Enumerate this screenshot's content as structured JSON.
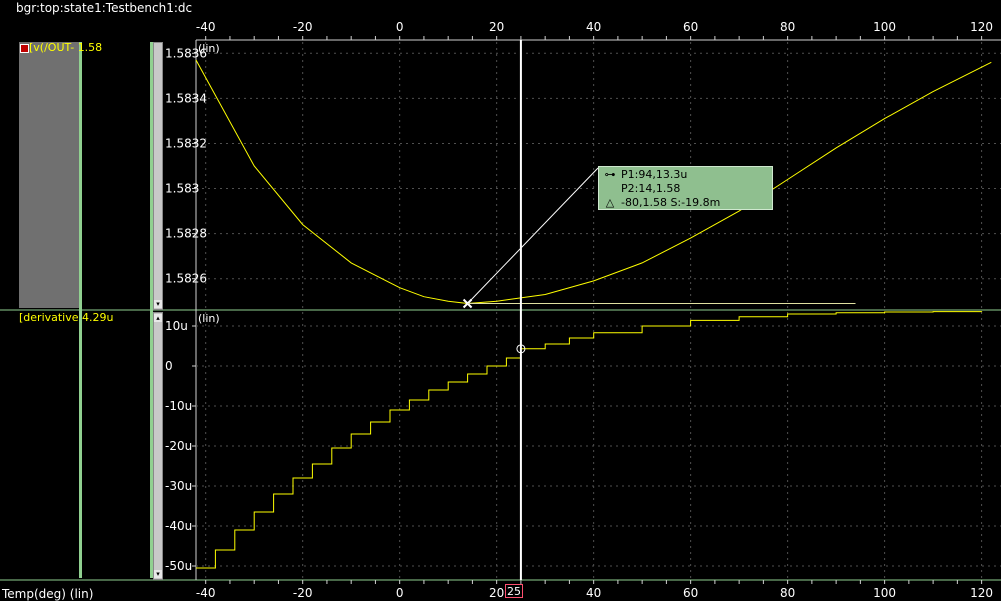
{
  "window": {
    "title": "bgr:top:state1:Testbench1:dc"
  },
  "panels": {
    "top": {
      "signal_name": "[v(/OUT-",
      "signal_value": "1.58",
      "scale_label": "(lin)"
    },
    "bottom": {
      "signal_name": "[derivative",
      "signal_value": "4.29u",
      "scale_label": "(lin)"
    }
  },
  "x_axis": {
    "label": "Temp(deg) (lin)",
    "cursor_value": "25"
  },
  "tooltip": {
    "p1": "P1:94,13.3u",
    "p2": "P2:14,1.58",
    "delta": "-80,1.58 S:-19.8m",
    "p1_icon": "line-segment-icon",
    "delta_icon": "triangle-icon"
  },
  "colors": {
    "trace": "#ffff00",
    "grid": "#505050",
    "cursor": "#ffffff",
    "separator": "#90d090"
  },
  "chart_data": [
    {
      "type": "line",
      "series": [
        {
          "name": "[v(/OUT-",
          "x": [
            -42,
            -30,
            -20,
            -10,
            0,
            5,
            10,
            14,
            20,
            30,
            40,
            50,
            60,
            70,
            80,
            90,
            100,
            110,
            122
          ],
          "y": [
            1.58357,
            1.5831,
            1.58284,
            1.58267,
            1.58256,
            1.58252,
            1.5825,
            1.58249,
            1.5825,
            1.58253,
            1.58259,
            1.58267,
            1.58278,
            1.5829,
            1.58304,
            1.58318,
            1.58331,
            1.58343,
            1.58356
          ]
        }
      ],
      "xlim": [
        -42,
        124
      ],
      "ylim": [
        1.58247,
        1.58365
      ],
      "x_ticks": [
        "-40",
        "-20",
        "0",
        "20",
        "40",
        "60",
        "80",
        "100",
        "120"
      ],
      "y_ticks": [
        "1.5836",
        "1.5834",
        "1.5832",
        "1.583",
        "1.5828",
        "1.5826"
      ],
      "y_tick_values": [
        1.5836,
        1.5834,
        1.5832,
        1.583,
        1.5828,
        1.5826
      ],
      "markers": [
        {
          "x": 14,
          "y": 1.58249
        }
      ],
      "cursor_x": 25
    },
    {
      "type": "line",
      "series": [
        {
          "name": "[derivative",
          "x": [
            -42,
            -38,
            -34,
            -30,
            -26,
            -22,
            -18,
            -14,
            -10,
            -6,
            -2,
            2,
            6,
            10,
            14,
            18,
            22,
            25,
            30,
            35,
            40,
            50,
            60,
            70,
            80,
            90,
            100,
            110,
            120
          ],
          "y": [
            -50.5,
            -46,
            -41,
            -36.5,
            -32,
            -28,
            -24.5,
            -20.5,
            -17,
            -14,
            -11,
            -8.5,
            -6,
            -4,
            -2,
            0,
            2,
            4.3,
            5.5,
            7,
            8.3,
            10,
            11.4,
            12.3,
            13,
            13.3,
            13.5,
            13.6,
            13.7
          ]
        }
      ],
      "xlim": [
        -42,
        124
      ],
      "ylim": [
        -53,
        13.5
      ],
      "y_ticks": [
        "10u",
        "0",
        "-10u",
        "-20u",
        "-30u",
        "-40u",
        "-50u"
      ],
      "y_tick_values": [
        10,
        0,
        -10,
        -20,
        -30,
        -40,
        -50
      ],
      "markers": [
        {
          "x": 25,
          "y": 4.29
        }
      ],
      "cursor_x": 25
    }
  ]
}
